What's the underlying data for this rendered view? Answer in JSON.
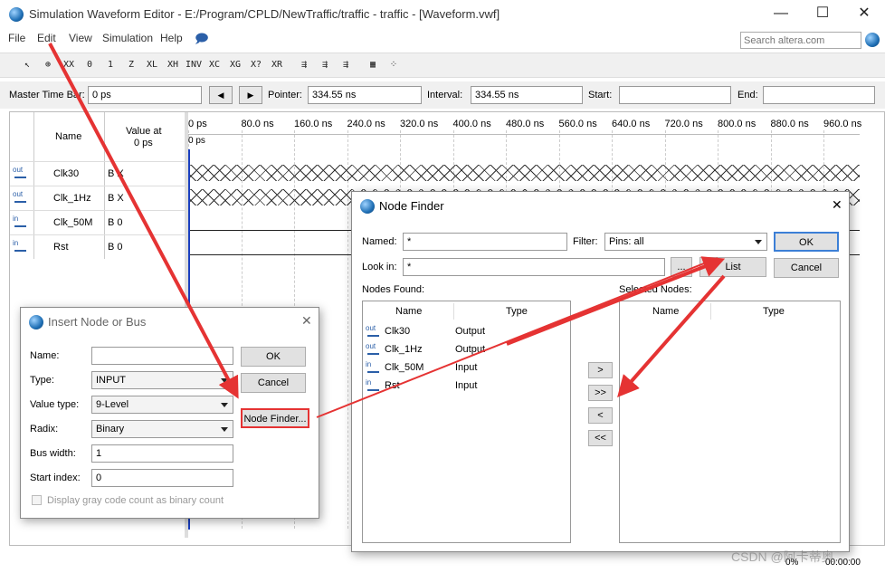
{
  "window": {
    "title": "Simulation Waveform Editor - E:/Program/CPLD/NewTraffic/traffic - traffic - [Waveform.vwf]",
    "minimize": "—",
    "maximize": "☐",
    "close": "✕"
  },
  "menu": [
    "File",
    "Edit",
    "View",
    "Simulation",
    "Help"
  ],
  "search": {
    "placeholder": "Search altera.com"
  },
  "toolbar": [
    "↖",
    "⊕",
    "XX",
    "0",
    "1",
    "Z",
    "XL",
    "XH",
    "INV",
    "XC",
    "XG",
    "X?",
    "XR",
    "⇶",
    "⇶",
    "⇶",
    "▦",
    "⁘"
  ],
  "timebar": {
    "master_time_bar_label": "Master Time Bar:",
    "master_time_bar_value": "0 ps",
    "prev": "◀",
    "next": "▶",
    "pointer_label": "Pointer:",
    "pointer_value": "334.55 ns",
    "interval_label": "Interval:",
    "interval_value": "334.55 ns",
    "start_label": "Start:",
    "start_value": "",
    "end_label": "End:",
    "end_value": ""
  },
  "waveform": {
    "col_name": "Name",
    "col_value": "Value at",
    "col_value_sub": "0 ps",
    "ruler": [
      "0 ps",
      "80.0 ns",
      "160.0 ns",
      "240.0 ns",
      "320.0 ns",
      "400.0 ns",
      "480.0 ns",
      "560.0 ns",
      "640.0 ns",
      "720.0 ns",
      "800.0 ns",
      "880.0 ns",
      "960.0 ns"
    ],
    "cursor_label": "0 ps",
    "rows": [
      {
        "dir": "out",
        "name": "Clk30",
        "value": "B X"
      },
      {
        "dir": "out",
        "name": "Clk_1Hz",
        "value": "B X"
      },
      {
        "dir": "in",
        "name": "Clk_50M",
        "value": "B 0"
      },
      {
        "dir": "in",
        "name": "Rst",
        "value": "B 0"
      }
    ]
  },
  "insert_node": {
    "title": "Insert Node or Bus",
    "name_label": "Name:",
    "name_value": "",
    "type_label": "Type:",
    "type_value": "INPUT",
    "value_type_label": "Value type:",
    "value_type_value": "9-Level",
    "radix_label": "Radix:",
    "radix_value": "Binary",
    "bus_width_label": "Bus width:",
    "bus_width_value": "1",
    "start_index_label": "Start index:",
    "start_index_value": "0",
    "gray_label": "Display gray code count as binary count",
    "ok": "OK",
    "cancel": "Cancel",
    "node_finder": "Node Finder..."
  },
  "node_finder": {
    "title": "Node Finder",
    "named_label": "Named:",
    "named_value": "*",
    "filter_label": "Filter:",
    "filter_value": "Pins: all",
    "look_in_label": "Look in:",
    "look_in_value": "*",
    "browse": "...",
    "ok": "OK",
    "list": "List",
    "cancel": "Cancel",
    "nodes_found_label": "Nodes Found:",
    "selected_nodes_label": "Selected Nodes:",
    "col_name": "Name",
    "col_type": "Type",
    "nodes": [
      {
        "dir": "out",
        "name": "Clk30",
        "type": "Output"
      },
      {
        "dir": "out",
        "name": "Clk_1Hz",
        "type": "Output"
      },
      {
        "dir": "in",
        "name": "Clk_50M",
        "type": "Input"
      },
      {
        "dir": "in",
        "name": "Rst",
        "type": "Input"
      }
    ],
    "move_one": ">",
    "move_all": ">>",
    "remove_one": "<",
    "remove_all": "<<"
  },
  "status": {
    "percent": "0%",
    "time": "00:00:00"
  },
  "watermark": "CSDN @阿卡蒂奥",
  "colors": {
    "annotation": "#e53333",
    "accent": "#2b5fa8"
  }
}
